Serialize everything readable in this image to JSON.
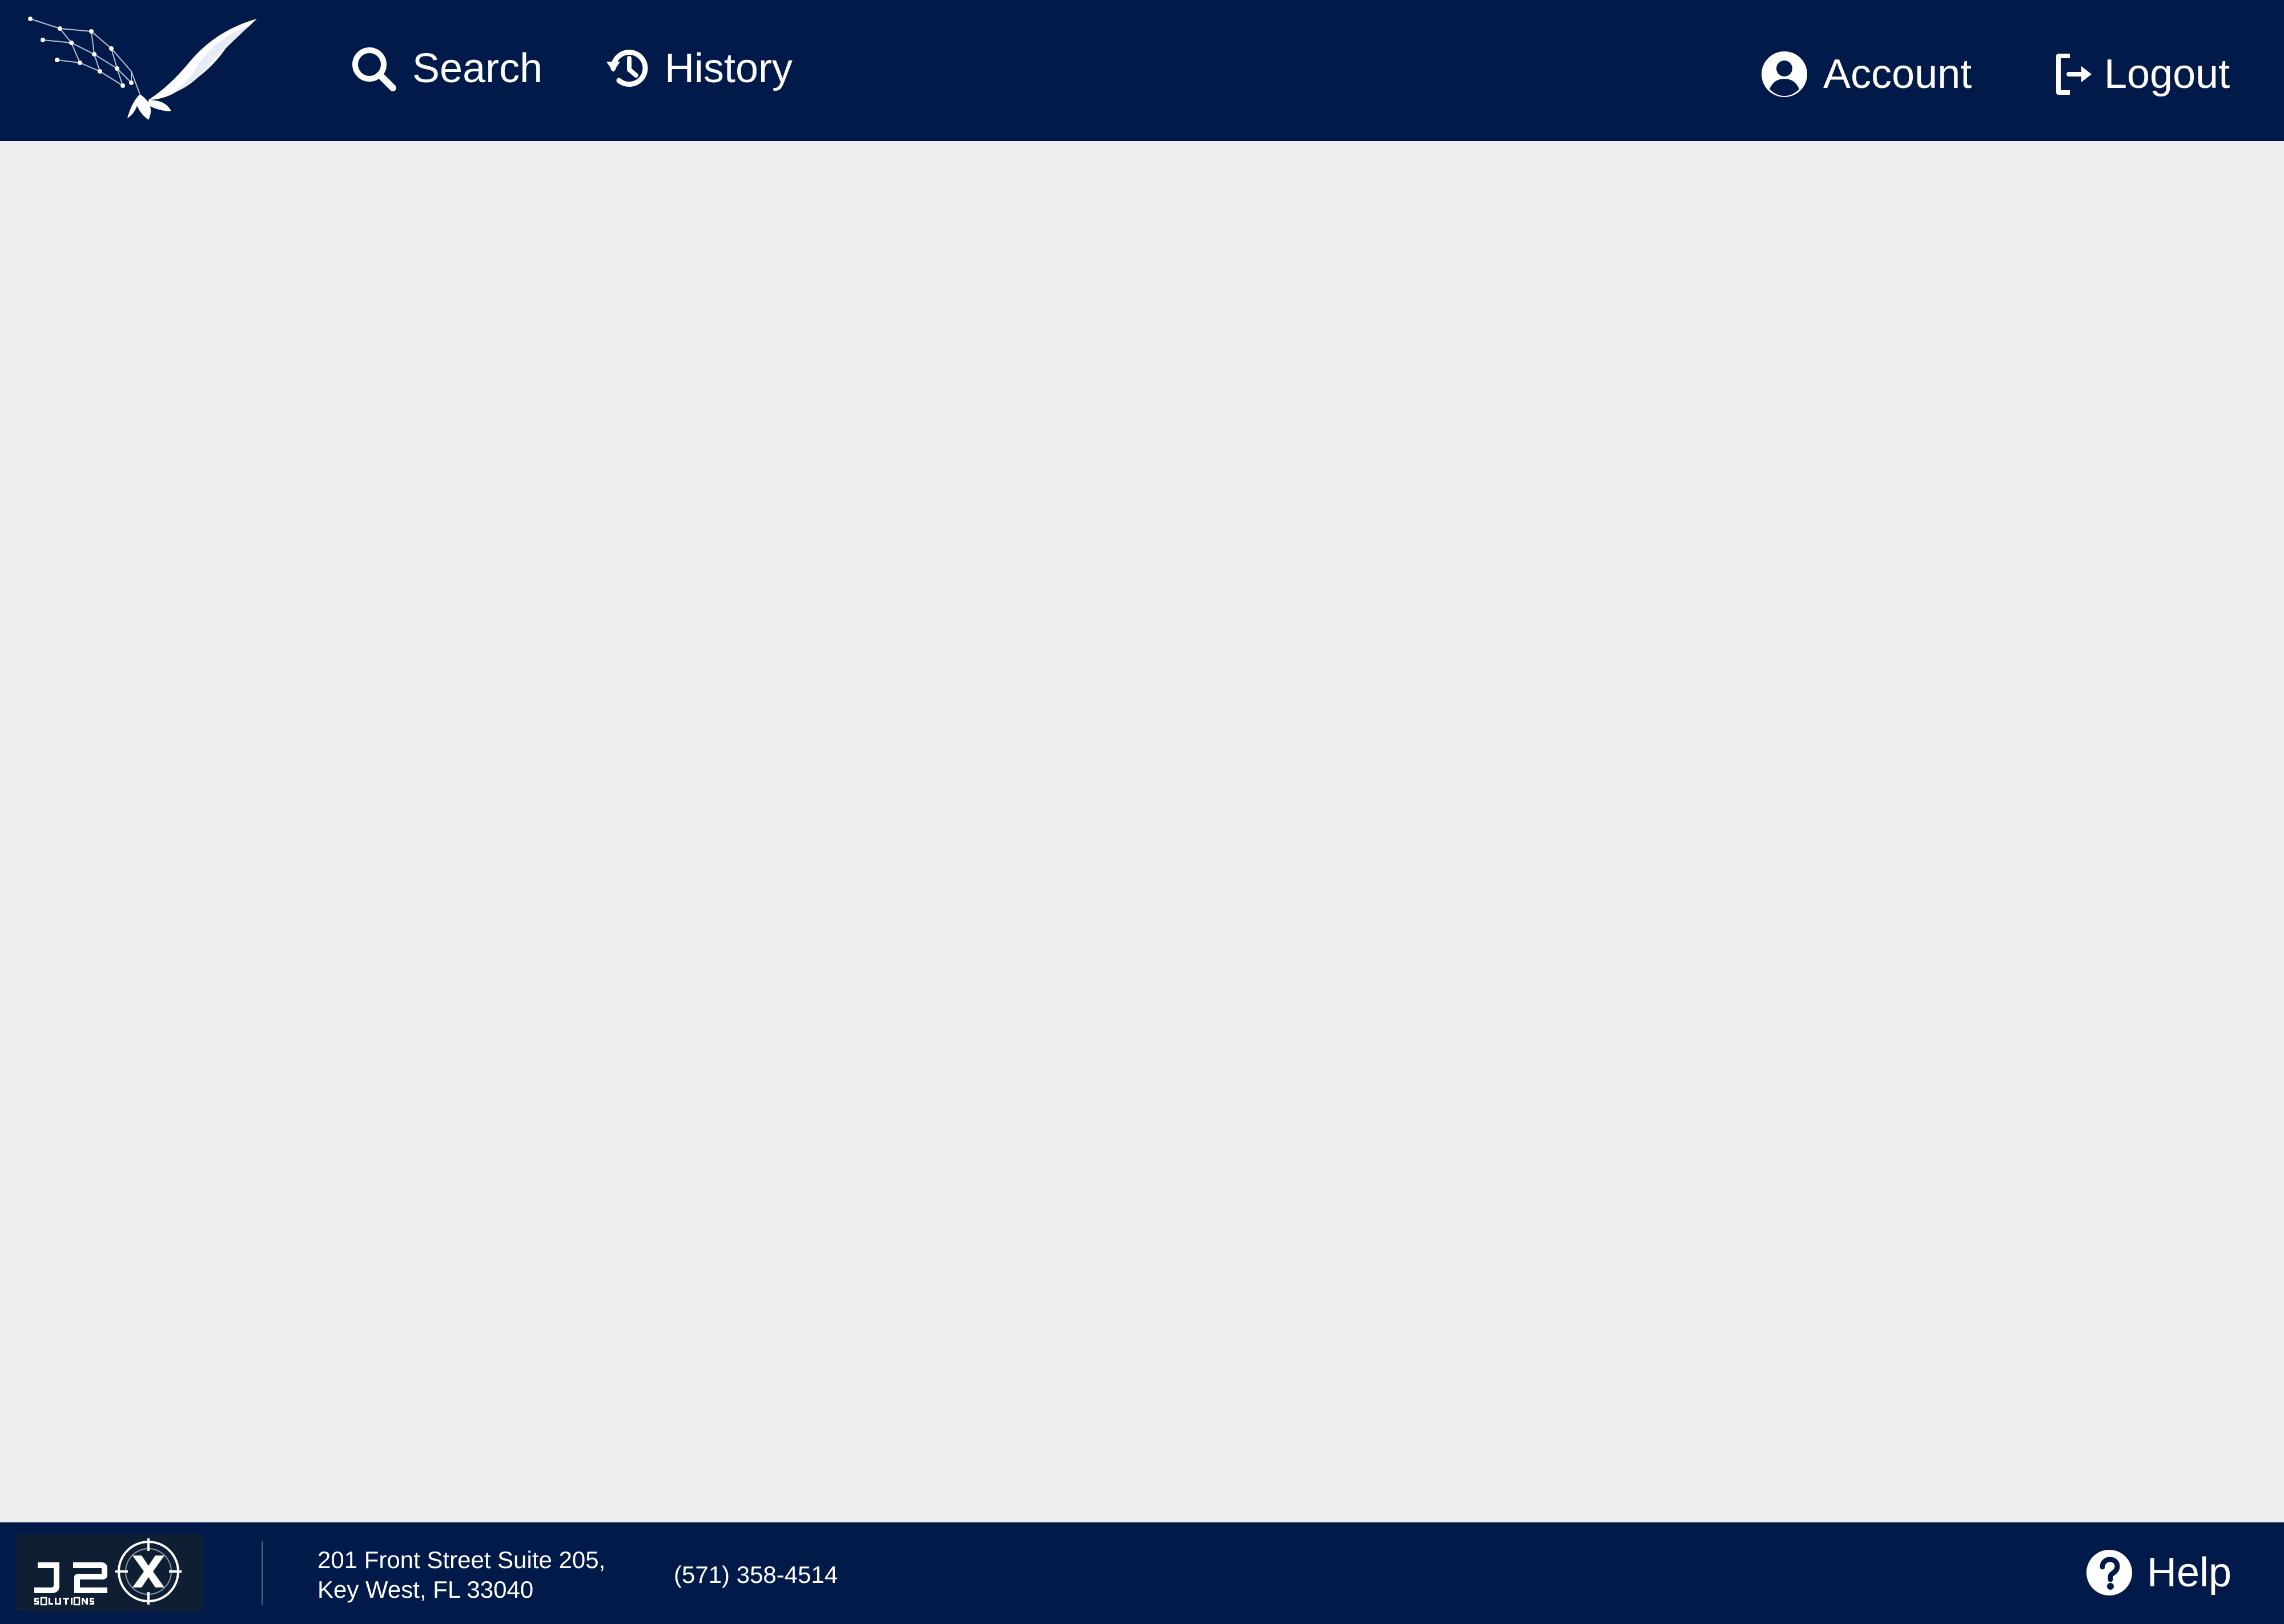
{
  "header": {
    "logo_icon": "eagle-logo",
    "nav": {
      "search": {
        "label": "Search",
        "icon": "search-icon"
      },
      "history": {
        "label": "History",
        "icon": "history-icon"
      },
      "account": {
        "label": "Account",
        "icon": "account-icon"
      },
      "logout": {
        "label": "Logout",
        "icon": "logout-icon"
      }
    }
  },
  "footer": {
    "logo_icon": "j2x-solutions-logo",
    "address_line1": "201 Front Street Suite 205,",
    "address_line2": "Key West, FL 33040",
    "phone": "(571) 358-4514",
    "help": {
      "label": "Help",
      "icon": "help-icon"
    }
  },
  "colors": {
    "navbar": "#021a4a",
    "background": "#eeeeee",
    "text": "#ffffff"
  }
}
